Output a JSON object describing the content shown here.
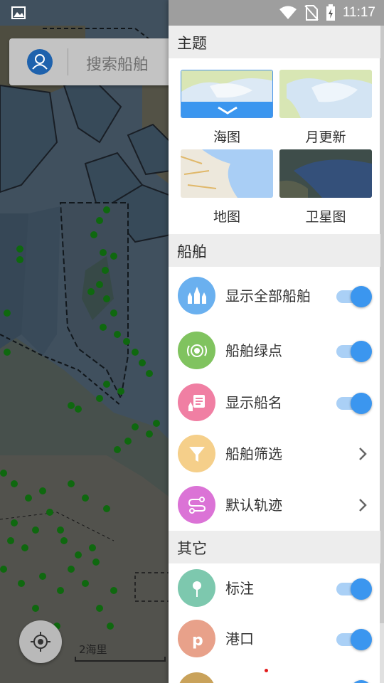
{
  "status_bar": {
    "time": "11:17",
    "icons": [
      "image-icon",
      "wifi-icon",
      "no-sim-icon",
      "battery-charging-icon"
    ]
  },
  "search": {
    "placeholder": "搜索船舶",
    "avatar_icon": "user-icon"
  },
  "map": {
    "scale_label": "2海里",
    "locate_icon": "crosshair-icon"
  },
  "drawer": {
    "theme_section": {
      "title": "主题",
      "options": [
        {
          "label": "海图",
          "selected": true
        },
        {
          "label": "月更新",
          "selected": false
        },
        {
          "label": "地图",
          "selected": false
        },
        {
          "label": "卫星图",
          "selected": false
        }
      ]
    },
    "ship_section": {
      "title": "船舶",
      "items": [
        {
          "label": "显示全部船舶",
          "icon": "ships-icon",
          "color": "#6ab0ef",
          "control": "toggle",
          "on": true
        },
        {
          "label": "船舶绿点",
          "icon": "radar-icon",
          "color": "#80c35f",
          "control": "toggle",
          "on": true
        },
        {
          "label": "显示船名",
          "icon": "ship-name-icon",
          "color": "#f07fa3",
          "control": "toggle",
          "on": true
        },
        {
          "label": "船舶筛选",
          "icon": "filter-icon",
          "color": "#f5cf8a",
          "control": "chevron"
        },
        {
          "label": "默认轨迹",
          "icon": "track-icon",
          "color": "#db73d6",
          "control": "chevron"
        }
      ]
    },
    "other_section": {
      "title": "其它",
      "items": [
        {
          "label": "标注",
          "icon": "pin-icon",
          "color": "#7dc8ae",
          "control": "toggle",
          "on": true
        },
        {
          "label": "港口",
          "icon": "port-icon",
          "color": "#e8a18a",
          "control": "toggle",
          "on": true
        }
      ]
    },
    "toggle_color": "#3b96ef"
  }
}
